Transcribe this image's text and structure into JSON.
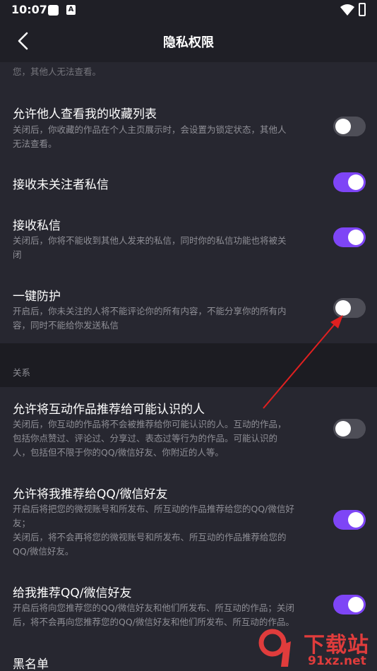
{
  "status_bar": {
    "time": "10:07",
    "notif_a": "A"
  },
  "header": {
    "title": "隐私权限"
  },
  "partial_top_text": "您，其他人无法查看。",
  "items": [
    {
      "title": "允许他人查看我的收藏列表",
      "desc": [
        "关闭后，你收藏的作品在个人主页展示时，会设置为锁定状态，其他人",
        "无法查看。"
      ],
      "toggle": "off"
    },
    {
      "title": "接收未关注者私信",
      "desc": [],
      "toggle": "on"
    },
    {
      "title": "接收私信",
      "desc": [
        "关闭后，你将不能收到其他人发来的私信，同时你的私信功能也将被关",
        "闭"
      ],
      "toggle": "on"
    },
    {
      "title": "一键防护",
      "desc": [
        "开启后，你未关注的人将不能评论你的所有内容，不能分享你的所有内",
        "容，同时不能给你发送私信"
      ],
      "toggle": "off"
    }
  ],
  "section": {
    "label": "关系"
  },
  "relation_items": [
    {
      "title": "允许将互动作品推荐给可能认识的人",
      "desc": [
        "关闭后，你互动的作品将不会被推荐给你可能认识的人。互动的作品，",
        "包括你点赞过、评论过、分享过、表态过等行为的作品。可能认识的",
        "人，包括但不限于你的QQ/微信好友、你附近的人等。"
      ],
      "toggle": "off"
    },
    {
      "title": "允许将我推荐给QQ/微信好友",
      "desc": [
        "开启后将把您的微视账号和所发布、所互动的作品推荐给您的QQ/微信好",
        "友；",
        "关闭后，将不会再将您的微视账号和所发布、所互动的作品推荐给您的",
        "QQ/微信好友。"
      ],
      "toggle": "on"
    },
    {
      "title": "给我推荐QQ/微信好友",
      "desc": [
        "开启后将向您推荐您的QQ/微信好友和他们所发布、所互动的作品；关闭",
        "后，将不会再向您推荐您的QQ/微信好友和他们所发布、所互动的作品。"
      ],
      "toggle": "on"
    },
    {
      "title": "黑名单",
      "desc": [],
      "toggle": null
    }
  ],
  "watermark": {
    "text1": "下载站",
    "text2": "91xz.net"
  },
  "colors": {
    "bg": "#1f1f26",
    "card": "#272730",
    "toggle_on": "#7e45f6",
    "toggle_off": "#4e4e57",
    "arrow": "#e02020"
  }
}
